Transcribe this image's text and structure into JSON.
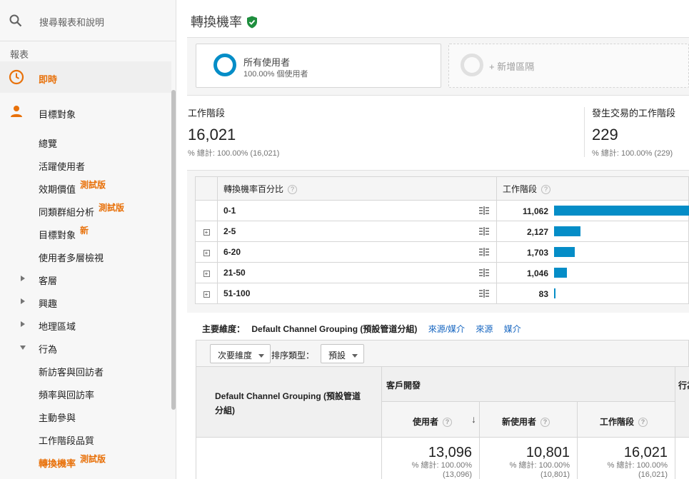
{
  "sidebar": {
    "search_placeholder": "搜尋報表和說明",
    "section_label": "報表",
    "realtime_label": "即時",
    "audience_label": "目標對象",
    "items": [
      {
        "label": "總覽",
        "badge": ""
      },
      {
        "label": "活躍使用者",
        "badge": ""
      },
      {
        "label": "效期價值",
        "badge": "測試版"
      },
      {
        "label": "同類群組分析",
        "badge": "測試版"
      },
      {
        "label": "目標對象",
        "badge": "新"
      },
      {
        "label": "使用者多層檢視",
        "badge": ""
      },
      {
        "label": "客層",
        "badge": ""
      },
      {
        "label": "興趣",
        "badge": ""
      },
      {
        "label": "地理區域",
        "badge": ""
      },
      {
        "label": "行為",
        "badge": ""
      },
      {
        "label": "新訪客與回訪者",
        "badge": ""
      },
      {
        "label": "頻率與回訪率",
        "badge": ""
      },
      {
        "label": "主動參與",
        "badge": ""
      },
      {
        "label": "工作階段品質",
        "badge": ""
      },
      {
        "label": "轉換機率",
        "badge": "測試版"
      }
    ]
  },
  "header": {
    "title": "轉換機率"
  },
  "segments": {
    "active_name": "所有使用者",
    "active_sub": "100.00% 個使用者",
    "add_label": "+ 新增區隔"
  },
  "metrics": [
    {
      "name": "工作階段",
      "value": "16,021",
      "pct": "% 總計: 100.00% (16,021)"
    },
    {
      "name": "發生交易的工作階段",
      "value": "229",
      "pct": "% 總計: 100.00% (229)"
    }
  ],
  "dist_table": {
    "col_dim": "轉換機率百分比",
    "col_val": "工作階段",
    "help": "?",
    "expand": "+",
    "rows": [
      {
        "label": "0-1",
        "value": "11,062",
        "fraction": 1.0
      },
      {
        "label": "2-5",
        "value": "2,127",
        "fraction": 0.1923
      },
      {
        "label": "6-20",
        "value": "1,703",
        "fraction": 0.1539
      },
      {
        "label": "21-50",
        "value": "1,046",
        "fraction": 0.0946
      },
      {
        "label": "51-100",
        "value": "83",
        "fraction": 0.0075
      }
    ]
  },
  "dimensions": {
    "label": "主要維度：",
    "selected": "Default Channel Grouping (預設管道分組)",
    "links": [
      "來源/媒介",
      "來源",
      "媒介"
    ]
  },
  "controls": {
    "secondary_dim": "次要維度",
    "sort_label": "排序類型：",
    "sort_value": "預設"
  },
  "table2": {
    "dim_header": "Default Channel Grouping (預設管道分組)",
    "group1": "客戶開發",
    "group2": "行為",
    "sort_arrow": "↓",
    "columns": [
      "使用者",
      "新使用者",
      "工作階段"
    ],
    "totals": [
      {
        "value": "13,096",
        "pct": "% 總計: 100.00%",
        "total": "(13,096)"
      },
      {
        "value": "10,801",
        "pct": "% 總計: 100.00%",
        "total": "(10,801)"
      },
      {
        "value": "16,021",
        "pct": "% 總計: 100.00%",
        "total": "(16,021)"
      }
    ]
  },
  "colors": {
    "accent_orange": "#e8710a",
    "bar_blue": "#058dc7",
    "link_blue": "#1565c0",
    "verified_green": "#1e8e3e"
  },
  "icons": [
    "search-icon",
    "clock-icon",
    "person-icon",
    "shield-check-icon",
    "segment-ring-icon",
    "row-options-icon"
  ]
}
